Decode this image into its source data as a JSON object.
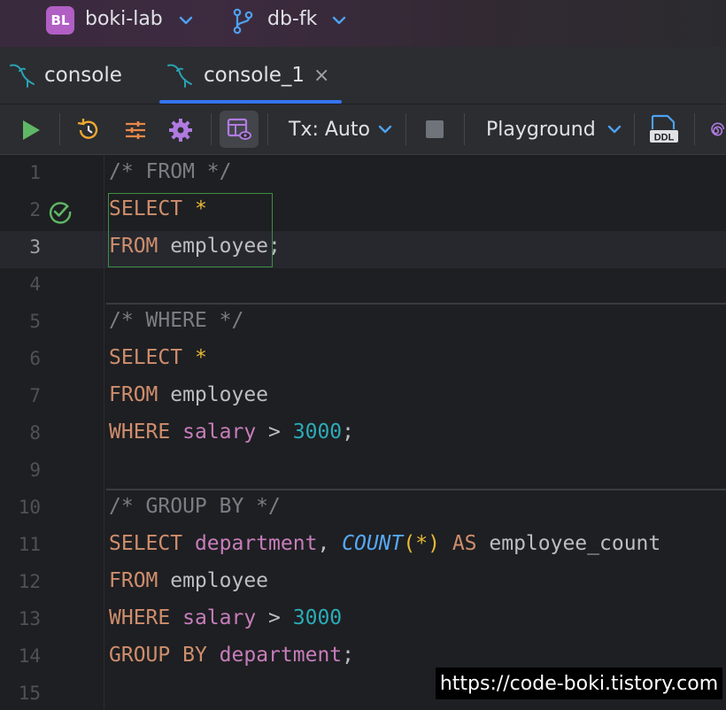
{
  "titlebar": {
    "project_badge": "BL",
    "project_name": "boki-lab",
    "branch_name": "db-fk"
  },
  "tabs": [
    {
      "label": "console",
      "active": false
    },
    {
      "label": "console_1",
      "active": true,
      "close": "×"
    }
  ],
  "toolbar": {
    "tx_mode": "Tx: Auto",
    "playground": "Playground",
    "ddl_label": "DDL"
  },
  "editor": {
    "current_line": 3,
    "line_numbers": [
      "1",
      "2",
      "3",
      "4",
      "5",
      "6",
      "7",
      "8",
      "9",
      "10",
      "11",
      "12",
      "13",
      "14",
      "15"
    ],
    "lines": [
      [
        {
          "t": "/* FROM */",
          "c": "c"
        }
      ],
      [
        {
          "t": "SELECT",
          "c": "k"
        },
        {
          "t": " "
        },
        {
          "t": "*",
          "c": "y"
        }
      ],
      [
        {
          "t": "FROM",
          "c": "k"
        },
        {
          "t": " employee;"
        }
      ],
      [],
      [
        {
          "t": "/* WHERE */",
          "c": "c"
        }
      ],
      [
        {
          "t": "SELECT",
          "c": "k"
        },
        {
          "t": " "
        },
        {
          "t": "*",
          "c": "y"
        }
      ],
      [
        {
          "t": "FROM",
          "c": "k"
        },
        {
          "t": " employee"
        }
      ],
      [
        {
          "t": "WHERE",
          "c": "k"
        },
        {
          "t": " "
        },
        {
          "t": "salary",
          "c": "p"
        },
        {
          "t": " > "
        },
        {
          "t": "3000",
          "c": "n"
        },
        {
          "t": ";"
        }
      ],
      [],
      [
        {
          "t": "/* GROUP BY */",
          "c": "c"
        }
      ],
      [
        {
          "t": "SELECT",
          "c": "k"
        },
        {
          "t": " "
        },
        {
          "t": "department",
          "c": "p"
        },
        {
          "t": ", "
        },
        {
          "t": "COUNT",
          "c": "f"
        },
        {
          "t": "(",
          "c": "y"
        },
        {
          "t": "*",
          "c": "y"
        },
        {
          "t": ")",
          "c": "y"
        },
        {
          "t": " "
        },
        {
          "t": "AS",
          "c": "k"
        },
        {
          "t": " employee_count"
        }
      ],
      [
        {
          "t": "FROM",
          "c": "k"
        },
        {
          "t": " employee"
        }
      ],
      [
        {
          "t": "WHERE",
          "c": "k"
        },
        {
          "t": " "
        },
        {
          "t": "salary",
          "c": "p"
        },
        {
          "t": " > "
        },
        {
          "t": "3000",
          "c": "n"
        }
      ],
      [
        {
          "t": "GROUP",
          "c": "k"
        },
        {
          "t": " "
        },
        {
          "t": "BY",
          "c": "k"
        },
        {
          "t": " "
        },
        {
          "t": "department",
          "c": "p"
        },
        {
          "t": ";"
        }
      ],
      []
    ],
    "run_status_icon": "check-circle-icon"
  },
  "watermark": "https://code-boki.tistory.com",
  "colors": {
    "keyword": "#cf8e6d",
    "comment": "#7a7e85",
    "column": "#c77dbb",
    "number": "#2aacb8",
    "function": "#56a8f5",
    "accent": "#3574f0",
    "run_green": "#5fb865"
  }
}
